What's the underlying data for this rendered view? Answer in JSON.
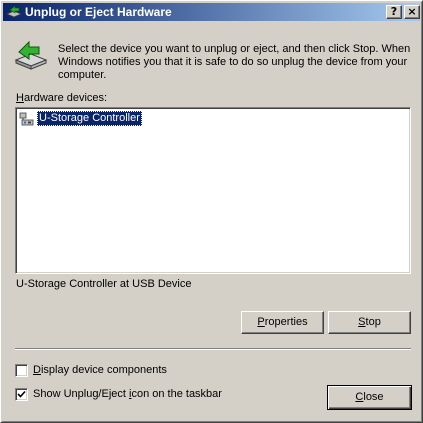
{
  "window": {
    "title": "Unplug or Eject Hardware",
    "help_button": "?",
    "close_button": "×"
  },
  "intro_text": "Select the device you want to unplug or eject, and then click Stop. When Windows notifies you that it is safe to do so unplug the device from your computer.",
  "hardware_devices": {
    "label_accel": "H",
    "label_rest": "ardware devices:",
    "items": [
      {
        "label": "U-Storage Controller",
        "icon": "usb-device-icon",
        "selected": true
      }
    ]
  },
  "device_description": "U-Storage Controller at USB Device",
  "buttons": {
    "properties_accel": "P",
    "properties_rest": "roperties",
    "stop_accel": "S",
    "stop_rest": "top",
    "close_accel": "C",
    "close_rest": "lose"
  },
  "options": {
    "display_components": {
      "accel": "D",
      "rest": "isplay device components",
      "checked": false
    },
    "show_icon": {
      "prefix": "Show Unplug/Eject ",
      "accel": "i",
      "suffix": "con on the taskbar",
      "checked": true
    }
  },
  "colors": {
    "titlebar_start": "#0a246a",
    "titlebar_end": "#a6caf0",
    "face": "#d4d0c8",
    "selection": "#0a246a"
  }
}
